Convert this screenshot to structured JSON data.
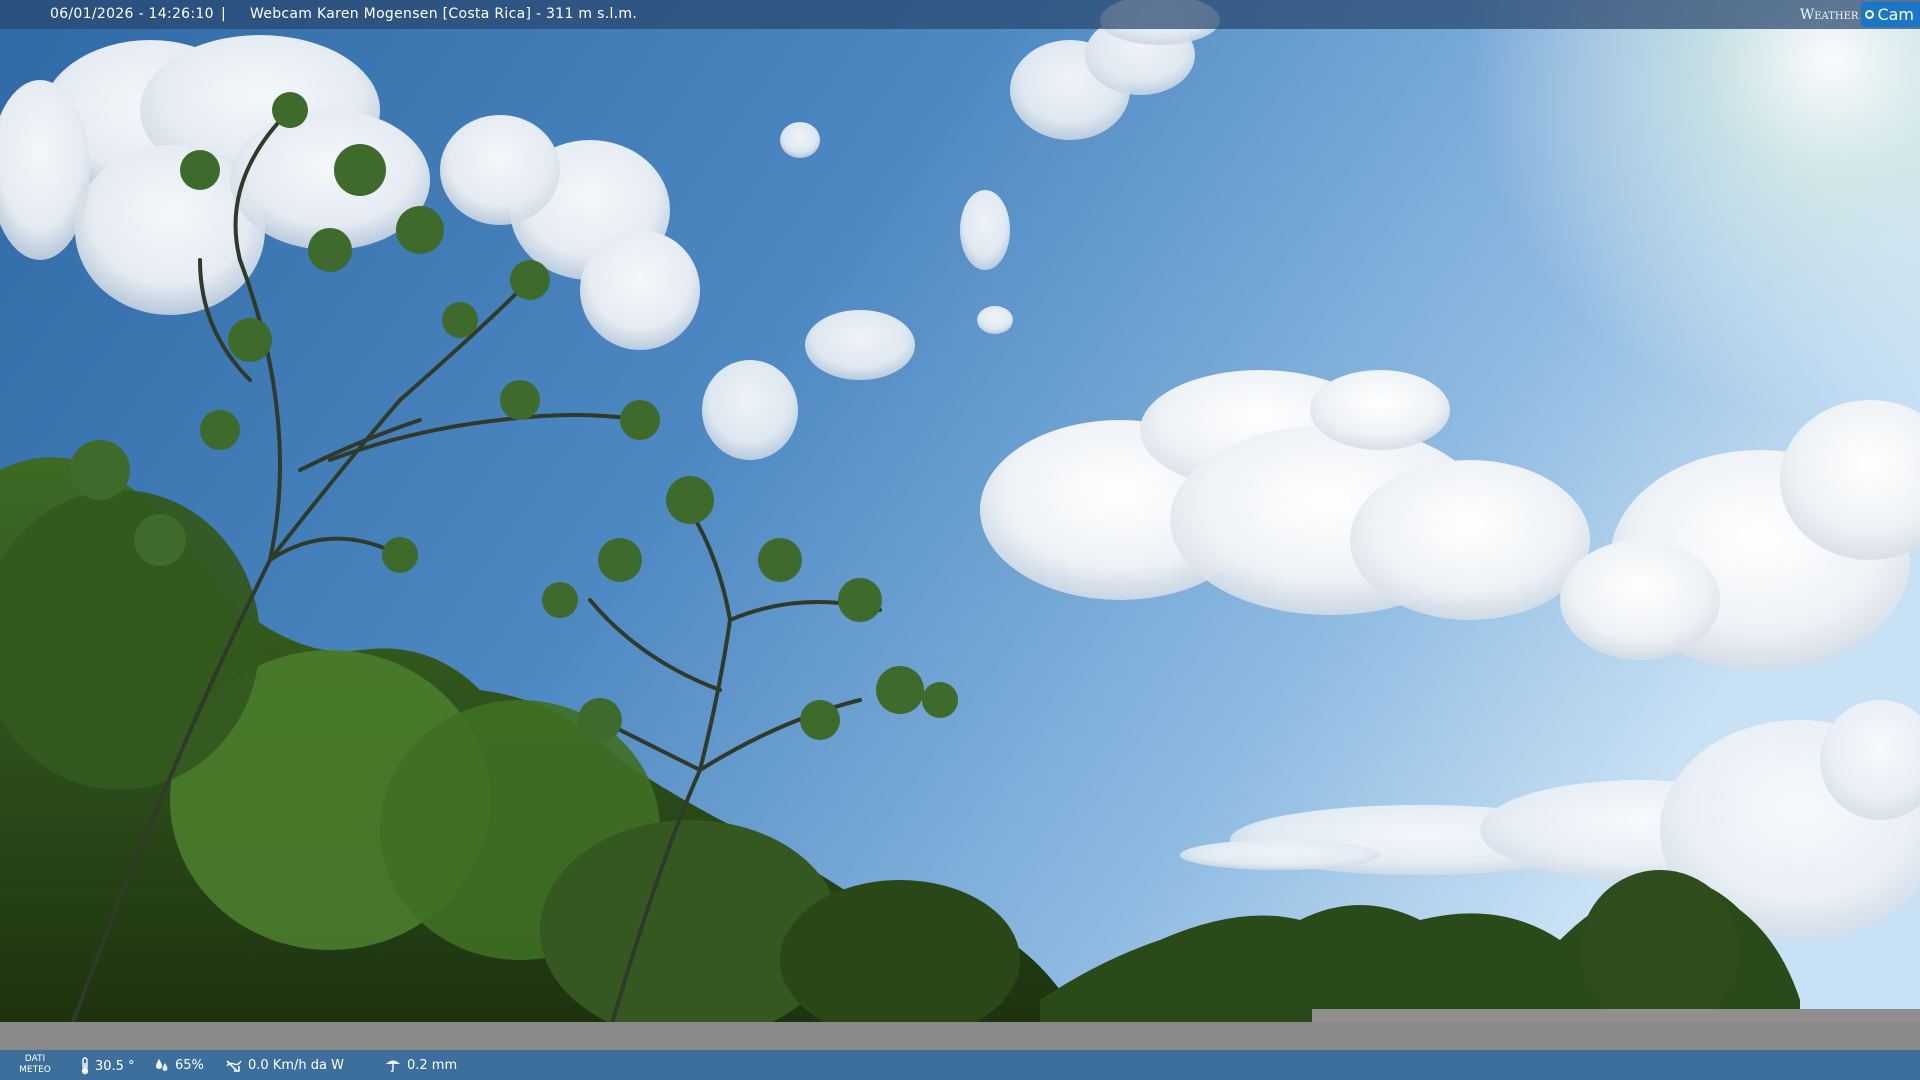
{
  "header": {
    "timestamp": "06/01/2026 - 14:26:10",
    "separator": "|",
    "title": "Webcam Karen Mogensen [Costa Rica]  - 311 m s.l.m.",
    "brand_weather": "Weather",
    "brand_cam": "Cam"
  },
  "footer": {
    "dati_line1": "DATI",
    "dati_line2": "METEO",
    "temperature": "30.5 °",
    "humidity": "65%",
    "wind": "0.0 Km/h da W",
    "rain": "0.2 mm"
  },
  "icons": {
    "temperature": "thermometer-icon",
    "humidity": "humidity-icon",
    "wind": "wind-icon",
    "rain": "rain-icon"
  },
  "colors": {
    "brand_blue": "#1b76c8",
    "bar_blue": "#3d6f9c",
    "sky": "#5c93c7"
  }
}
